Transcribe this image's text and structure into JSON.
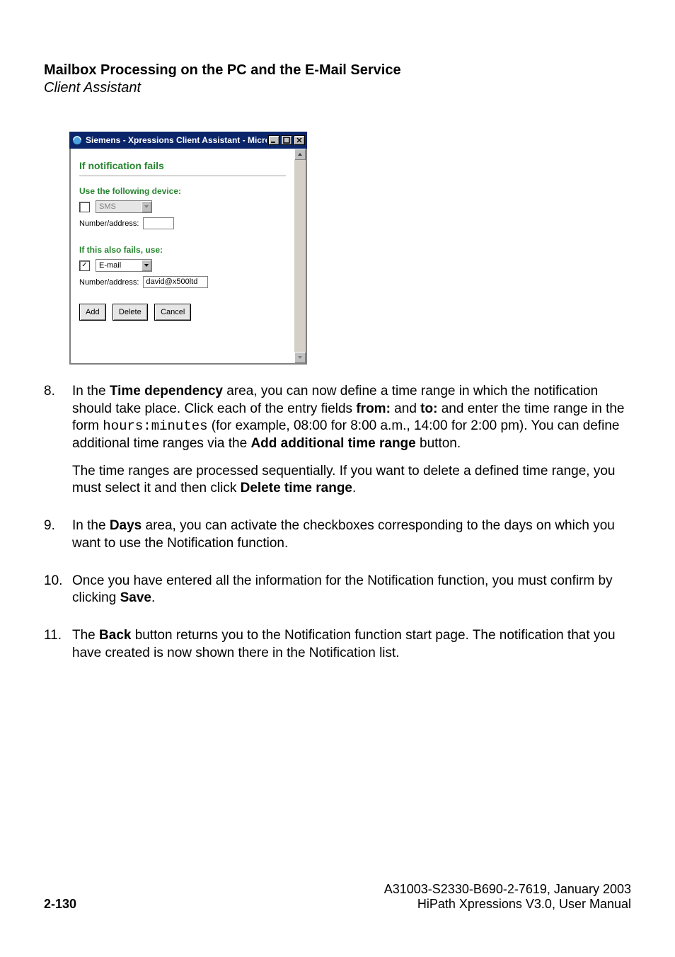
{
  "header": {
    "title": "Mailbox Processing on the PC and the E-Mail Service",
    "subtitle": "Client Assistant"
  },
  "dialog": {
    "window_title": "Siemens - Xpressions Client Assistant - Micros...",
    "heading": "If notification fails",
    "section1": {
      "label": "Use the following device:",
      "checkbox_checked": false,
      "select_value": "SMS",
      "select_enabled": false,
      "addr_label": "Number/address:",
      "addr_value": ""
    },
    "section2": {
      "label": "If this also fails, use:",
      "checkbox_checked": true,
      "select_value": "E-mail",
      "select_enabled": true,
      "addr_label": "Number/address:",
      "addr_value": "david@x500ltd"
    },
    "buttons": {
      "add": "Add",
      "delete": "Delete",
      "cancel": "Cancel"
    }
  },
  "para8": {
    "num": "8.",
    "t1": "In the ",
    "b1": "Time dependency",
    "t2": " area, you can now define a time range in which the notification should take place. Click each of the entry fields ",
    "b2": "from:",
    "t3": " and ",
    "b3": "to:",
    "t4": " and enter the time range in the form ",
    "mono": "hours:minutes",
    "t5": " (for example, 08:00 for 8:00 a.m., 14:00 for 2:00 pm).  You can define additional time ranges via the ",
    "b4": "Add additional time range",
    "t6": " button.",
    "p2a": "The time ranges are processed sequentially. If you want to delete a defined time range, you must select it and then click ",
    "p2b": "Delete time range",
    "p2c": "."
  },
  "para9": {
    "num": "9.",
    "t1": "In the ",
    "b1": "Days",
    "t2": " area, you can activate the checkboxes corresponding to the days on which you want to use the Notification function."
  },
  "para10": {
    "num": "10.",
    "t1": "Once you have entered all the information for the Notification function, you must confirm by clicking ",
    "b1": "Save",
    "t2": "."
  },
  "para11": {
    "num": "11.",
    "t1": "The ",
    "b1": "Back",
    "t2": " button returns you to the Notification function start page. The notification that you have created is now shown there in the Notification list."
  },
  "footer": {
    "page": "2-130",
    "line1": "A31003-S2330-B690-2-7619, January 2003",
    "line2": "HiPath Xpressions V3.0, User Manual"
  }
}
